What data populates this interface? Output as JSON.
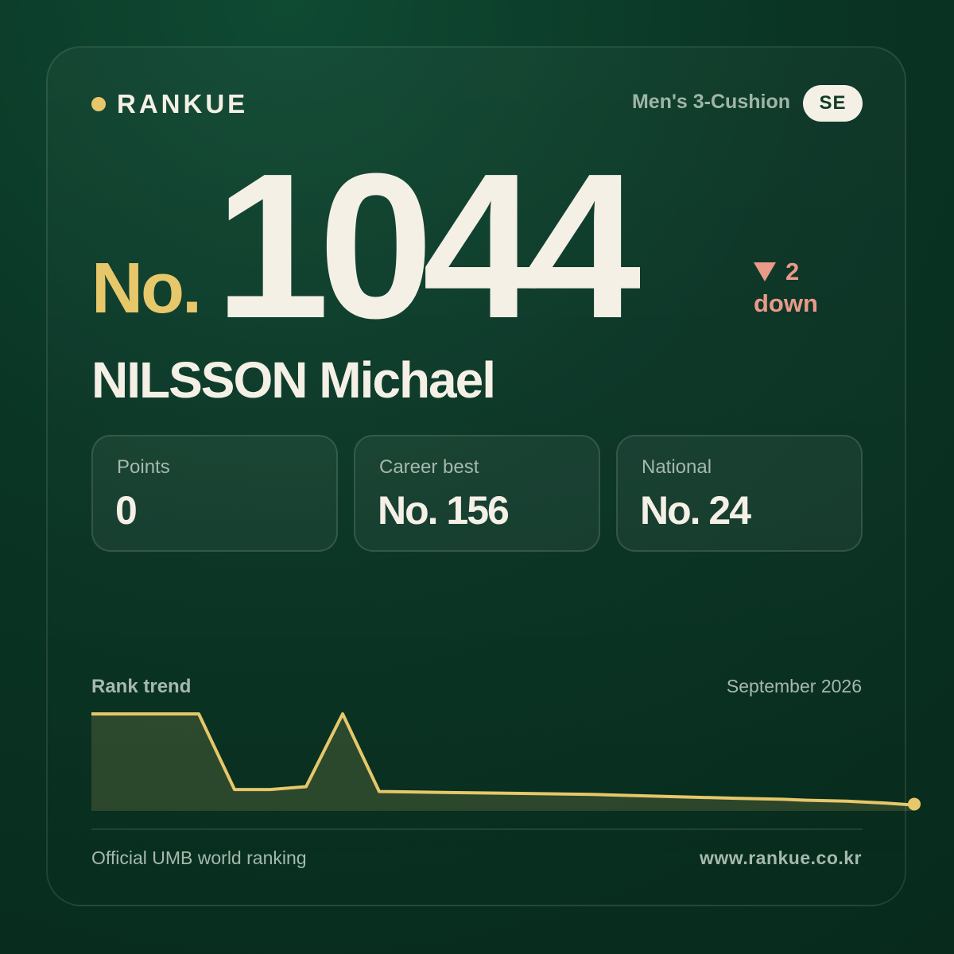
{
  "brand": {
    "name": "RANKUE"
  },
  "category": "Men's 3-Cushion",
  "country": "SE",
  "rank": {
    "prefix": "No.",
    "value": "1044"
  },
  "change": {
    "amount": "2",
    "direction": "down"
  },
  "player": {
    "name": "NILSSON Michael"
  },
  "stats": [
    {
      "label": "Points",
      "value": "0"
    },
    {
      "label": "Career best",
      "value": "No. 156"
    },
    {
      "label": "National",
      "value": "No. 24"
    }
  ],
  "trend": {
    "title": "Rank trend",
    "date": "September 2026"
  },
  "footer": {
    "left": "Official UMB world ranking",
    "right": "www.rankue.co.kr"
  },
  "colors": {
    "accent": "#e6c76a",
    "down": "#e99a88",
    "background": "#0a3424",
    "text": "#f4f0e6"
  },
  "chart_data": {
    "type": "area",
    "points": [
      1,
      1,
      0.22,
      0.22,
      0.25,
      1,
      0.2,
      0.19,
      0.18,
      0.17,
      0.15,
      0.13,
      0.12,
      0.11,
      0.1,
      0.08,
      0.06,
      0.07
    ],
    "last_point_marker": true
  }
}
